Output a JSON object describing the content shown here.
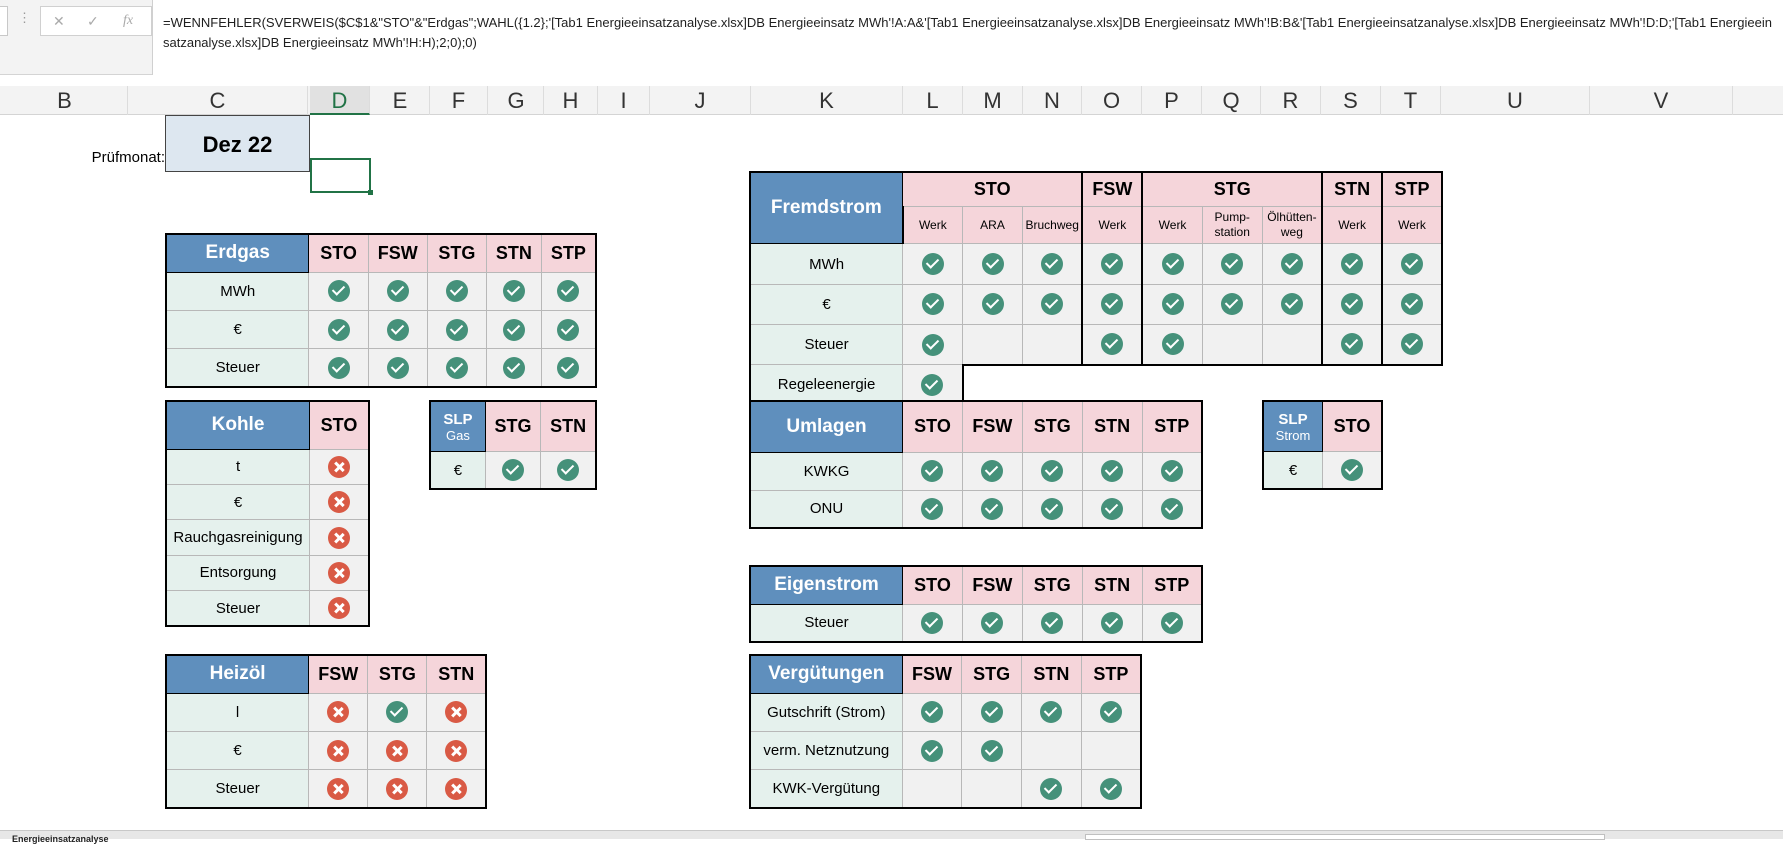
{
  "formula_bar": {
    "dots": "⋮",
    "cancel_icon": "✕",
    "enter_icon": "✓",
    "fx_label": "fx",
    "formula": "=WENNFEHLER(SVERWEIS($C$1&\"STO\"&\"Erdgas\";WAHL({1.2};'[Tab1 Energieeinsatzanalyse.xlsx]DB Energieeinsatz MWh'!A:A&'[Tab1 Energieeinsatzanalyse.xlsx]DB Energieeinsatz MWh'!B:B&'[Tab1 Energieeinsatzanalyse.xlsx]DB Energieeinsatz MWh'!D:D;'[Tab1 Energieeinsatzanalyse.xlsx]DB Energieeinsatz MWh'!H:H);2;0);0)"
  },
  "columns": [
    "B",
    "C",
    "D",
    "E",
    "F",
    "G",
    "H",
    "I",
    "J",
    "K",
    "L",
    "M",
    "N",
    "O",
    "P",
    "Q",
    "R",
    "S",
    "T",
    "U",
    "V"
  ],
  "pruef": {
    "label": "Prüfmonat:",
    "value": "Dez 22"
  },
  "erdgas": {
    "title": "Erdgas",
    "cols": [
      "STO",
      "FSW",
      "STG",
      "STN",
      "STP"
    ],
    "rows": [
      {
        "label": "MWh",
        "v": [
          "ok",
          "ok",
          "ok",
          "ok",
          "ok"
        ]
      },
      {
        "label": "€",
        "v": [
          "ok",
          "ok",
          "ok",
          "ok",
          "ok"
        ]
      },
      {
        "label": "Steuer",
        "v": [
          "ok",
          "ok",
          "ok",
          "ok",
          "ok"
        ]
      }
    ]
  },
  "kohle": {
    "title": "Kohle",
    "cols": [
      "STO"
    ],
    "rows": [
      {
        "label": "t",
        "v": [
          "err"
        ]
      },
      {
        "label": "€",
        "v": [
          "err"
        ]
      },
      {
        "label": "Rauchgasreinigung",
        "v": [
          "err"
        ]
      },
      {
        "label": "Entsorgung",
        "v": [
          "err"
        ]
      },
      {
        "label": "Steuer",
        "v": [
          "err"
        ]
      }
    ]
  },
  "slpgas": {
    "title1": "SLP",
    "title2": "Gas",
    "cols": [
      "STG",
      "STN"
    ],
    "rows": [
      {
        "label": "€",
        "v": [
          "ok",
          "ok"
        ]
      }
    ]
  },
  "heizoel": {
    "title": "Heizöl",
    "cols": [
      "FSW",
      "STG",
      "STN"
    ],
    "rows": [
      {
        "label": "l",
        "v": [
          "err",
          "ok",
          "err"
        ]
      },
      {
        "label": "€",
        "v": [
          "err",
          "err",
          "err"
        ]
      },
      {
        "label": "Steuer",
        "v": [
          "err",
          "err",
          "err"
        ]
      }
    ]
  },
  "fremdstrom": {
    "title": "Fremdstrom",
    "groups": [
      {
        "name": "STO",
        "subs": [
          "Werk",
          "ARA",
          "Bruchweg"
        ]
      },
      {
        "name": "FSW",
        "subs": [
          "Werk"
        ]
      },
      {
        "name": "STG",
        "subs": [
          "Werk",
          "Pump-station",
          "Ölhütten-weg"
        ]
      },
      {
        "name": "STN",
        "subs": [
          "Werk"
        ]
      },
      {
        "name": "STP",
        "subs": [
          "Werk"
        ]
      }
    ],
    "rows": [
      {
        "label": "MWh",
        "v": [
          "ok",
          "ok",
          "ok",
          "ok",
          "ok",
          "ok",
          "ok",
          "ok",
          "ok"
        ]
      },
      {
        "label": "€",
        "v": [
          "ok",
          "ok",
          "ok",
          "ok",
          "ok",
          "ok",
          "ok",
          "ok",
          "ok"
        ]
      },
      {
        "label": "Steuer",
        "v": [
          "ok",
          "x",
          "x",
          "ok",
          "ok",
          "x",
          "x",
          "ok",
          "ok"
        ]
      }
    ],
    "extra": {
      "label": "Regeleenergie",
      "v": "ok"
    }
  },
  "umlagen": {
    "title": "Umlagen",
    "cols": [
      "STO",
      "FSW",
      "STG",
      "STN",
      "STP"
    ],
    "rows": [
      {
        "label": "KWKG",
        "v": [
          "ok",
          "ok",
          "ok",
          "ok",
          "ok"
        ]
      },
      {
        "label": "ONU",
        "v": [
          "ok",
          "ok",
          "ok",
          "ok",
          "ok"
        ]
      }
    ]
  },
  "slpstrom": {
    "title1": "SLP",
    "title2": "Strom",
    "cols": [
      "STO"
    ],
    "rows": [
      {
        "label": "€",
        "v": [
          "ok"
        ]
      }
    ]
  },
  "eigenstrom": {
    "title": "Eigenstrom",
    "cols": [
      "STO",
      "FSW",
      "STG",
      "STN",
      "STP"
    ],
    "rows": [
      {
        "label": "Steuer",
        "v": [
          "ok",
          "ok",
          "ok",
          "ok",
          "ok"
        ]
      }
    ]
  },
  "verguetungen": {
    "title": "Vergütungen",
    "cols": [
      "FSW",
      "STG",
      "STN",
      "STP"
    ],
    "rows": [
      {
        "label": "Gutschrift (Strom)",
        "v": [
          "ok",
          "ok",
          "ok",
          "ok"
        ]
      },
      {
        "label": "verm. Netznutzung",
        "v": [
          "ok",
          "ok",
          "x",
          "x"
        ]
      },
      {
        "label": "KWK-Vergütung",
        "v": [
          "x",
          "x",
          "ok",
          "ok"
        ]
      }
    ]
  },
  "sheet_tab": "Energieeinsatzanalyse"
}
